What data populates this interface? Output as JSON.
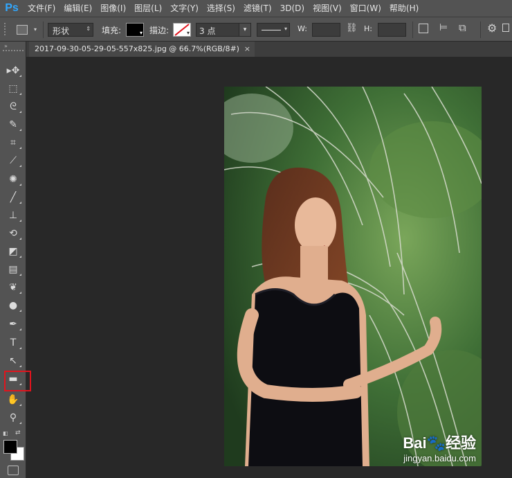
{
  "app": {
    "logo": "Ps"
  },
  "menu": [
    "文件(F)",
    "编辑(E)",
    "图像(I)",
    "图层(L)",
    "文字(Y)",
    "选择(S)",
    "滤镜(T)",
    "3D(D)",
    "视图(V)",
    "窗口(W)",
    "帮助(H)"
  ],
  "options": {
    "mode_value": "形状",
    "fill_label": "填充:",
    "stroke_label": "描边:",
    "stroke_size": "3 点",
    "w_label": "W:",
    "h_label": "H:",
    "fill_color": "#000000"
  },
  "document": {
    "tab_title": "2017-09-30-05-29-05-557x825.jpg @ 66.7%(RGB/8#)",
    "close_glyph": "×"
  },
  "tools": [
    {
      "name": "move-tool-icon",
      "glyph": "▸✥"
    },
    {
      "name": "marquee-tool-icon",
      "glyph": "⬚"
    },
    {
      "name": "lasso-tool-icon",
      "glyph": "ᘓ"
    },
    {
      "name": "quick-select-tool-icon",
      "glyph": "✎"
    },
    {
      "name": "crop-tool-icon",
      "glyph": "⌗"
    },
    {
      "name": "eyedropper-tool-icon",
      "glyph": "⟋"
    },
    {
      "name": "healing-brush-tool-icon",
      "glyph": "✺"
    },
    {
      "name": "brush-tool-icon",
      "glyph": "╱"
    },
    {
      "name": "stamp-tool-icon",
      "glyph": "⊥"
    },
    {
      "name": "history-brush-tool-icon",
      "glyph": "⟲"
    },
    {
      "name": "eraser-tool-icon",
      "glyph": "◩"
    },
    {
      "name": "gradient-tool-icon",
      "glyph": "▤"
    },
    {
      "name": "blur-tool-icon",
      "glyph": "❦"
    },
    {
      "name": "dodge-tool-icon",
      "glyph": "●"
    },
    {
      "name": "pen-tool-icon",
      "glyph": "✒"
    },
    {
      "name": "type-tool-icon",
      "glyph": "T"
    },
    {
      "name": "path-select-tool-icon",
      "glyph": "↖"
    },
    {
      "name": "rectangle-tool-icon",
      "glyph": "▬"
    },
    {
      "name": "hand-tool-icon",
      "glyph": "✋"
    },
    {
      "name": "zoom-tool-icon",
      "glyph": "⚲"
    }
  ],
  "colors": {
    "foreground": "#000000",
    "background": "#ffffff",
    "highlight": "#e1141d"
  },
  "watermark": {
    "brand": "Bai",
    "brand_cn": "经验",
    "url": "jingyan.baidu.com"
  }
}
